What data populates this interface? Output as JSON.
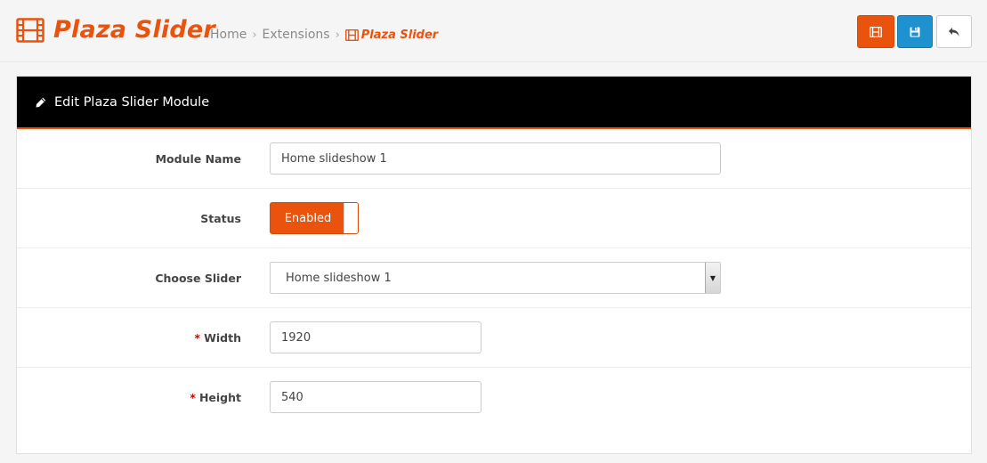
{
  "header": {
    "title": "Plaza Slider",
    "title_icon": "film-icon",
    "breadcrumb": [
      {
        "label": "Home"
      },
      {
        "label": "Extensions"
      },
      {
        "label": "Plaza Slider",
        "icon": "film-icon"
      }
    ],
    "buttons": [
      {
        "name": "slider-manager-button",
        "icon": "film-icon",
        "color": "#e9530d"
      },
      {
        "name": "save-button",
        "icon": "save-icon",
        "color": "#1e91cf"
      },
      {
        "name": "back-button",
        "icon": "reply-icon",
        "color": "#ffffff"
      }
    ]
  },
  "panel": {
    "heading": "Edit Plaza Slider Module",
    "heading_icon": "pencil-icon"
  },
  "form": {
    "module_name": {
      "label": "Module Name",
      "value": "Home slideshow 1"
    },
    "status": {
      "label": "Status",
      "value": "Enabled"
    },
    "choose_slider": {
      "label": "Choose Slider",
      "value": "Home slideshow 1"
    },
    "width": {
      "label": "Width",
      "required": "*",
      "value": "1920"
    },
    "height": {
      "label": "Height",
      "required": "*",
      "value": "540"
    }
  },
  "colors": {
    "accent": "#e9530d",
    "primary": "#1e91cf",
    "panel_heading_bg": "#000000",
    "required": "#d40000"
  }
}
